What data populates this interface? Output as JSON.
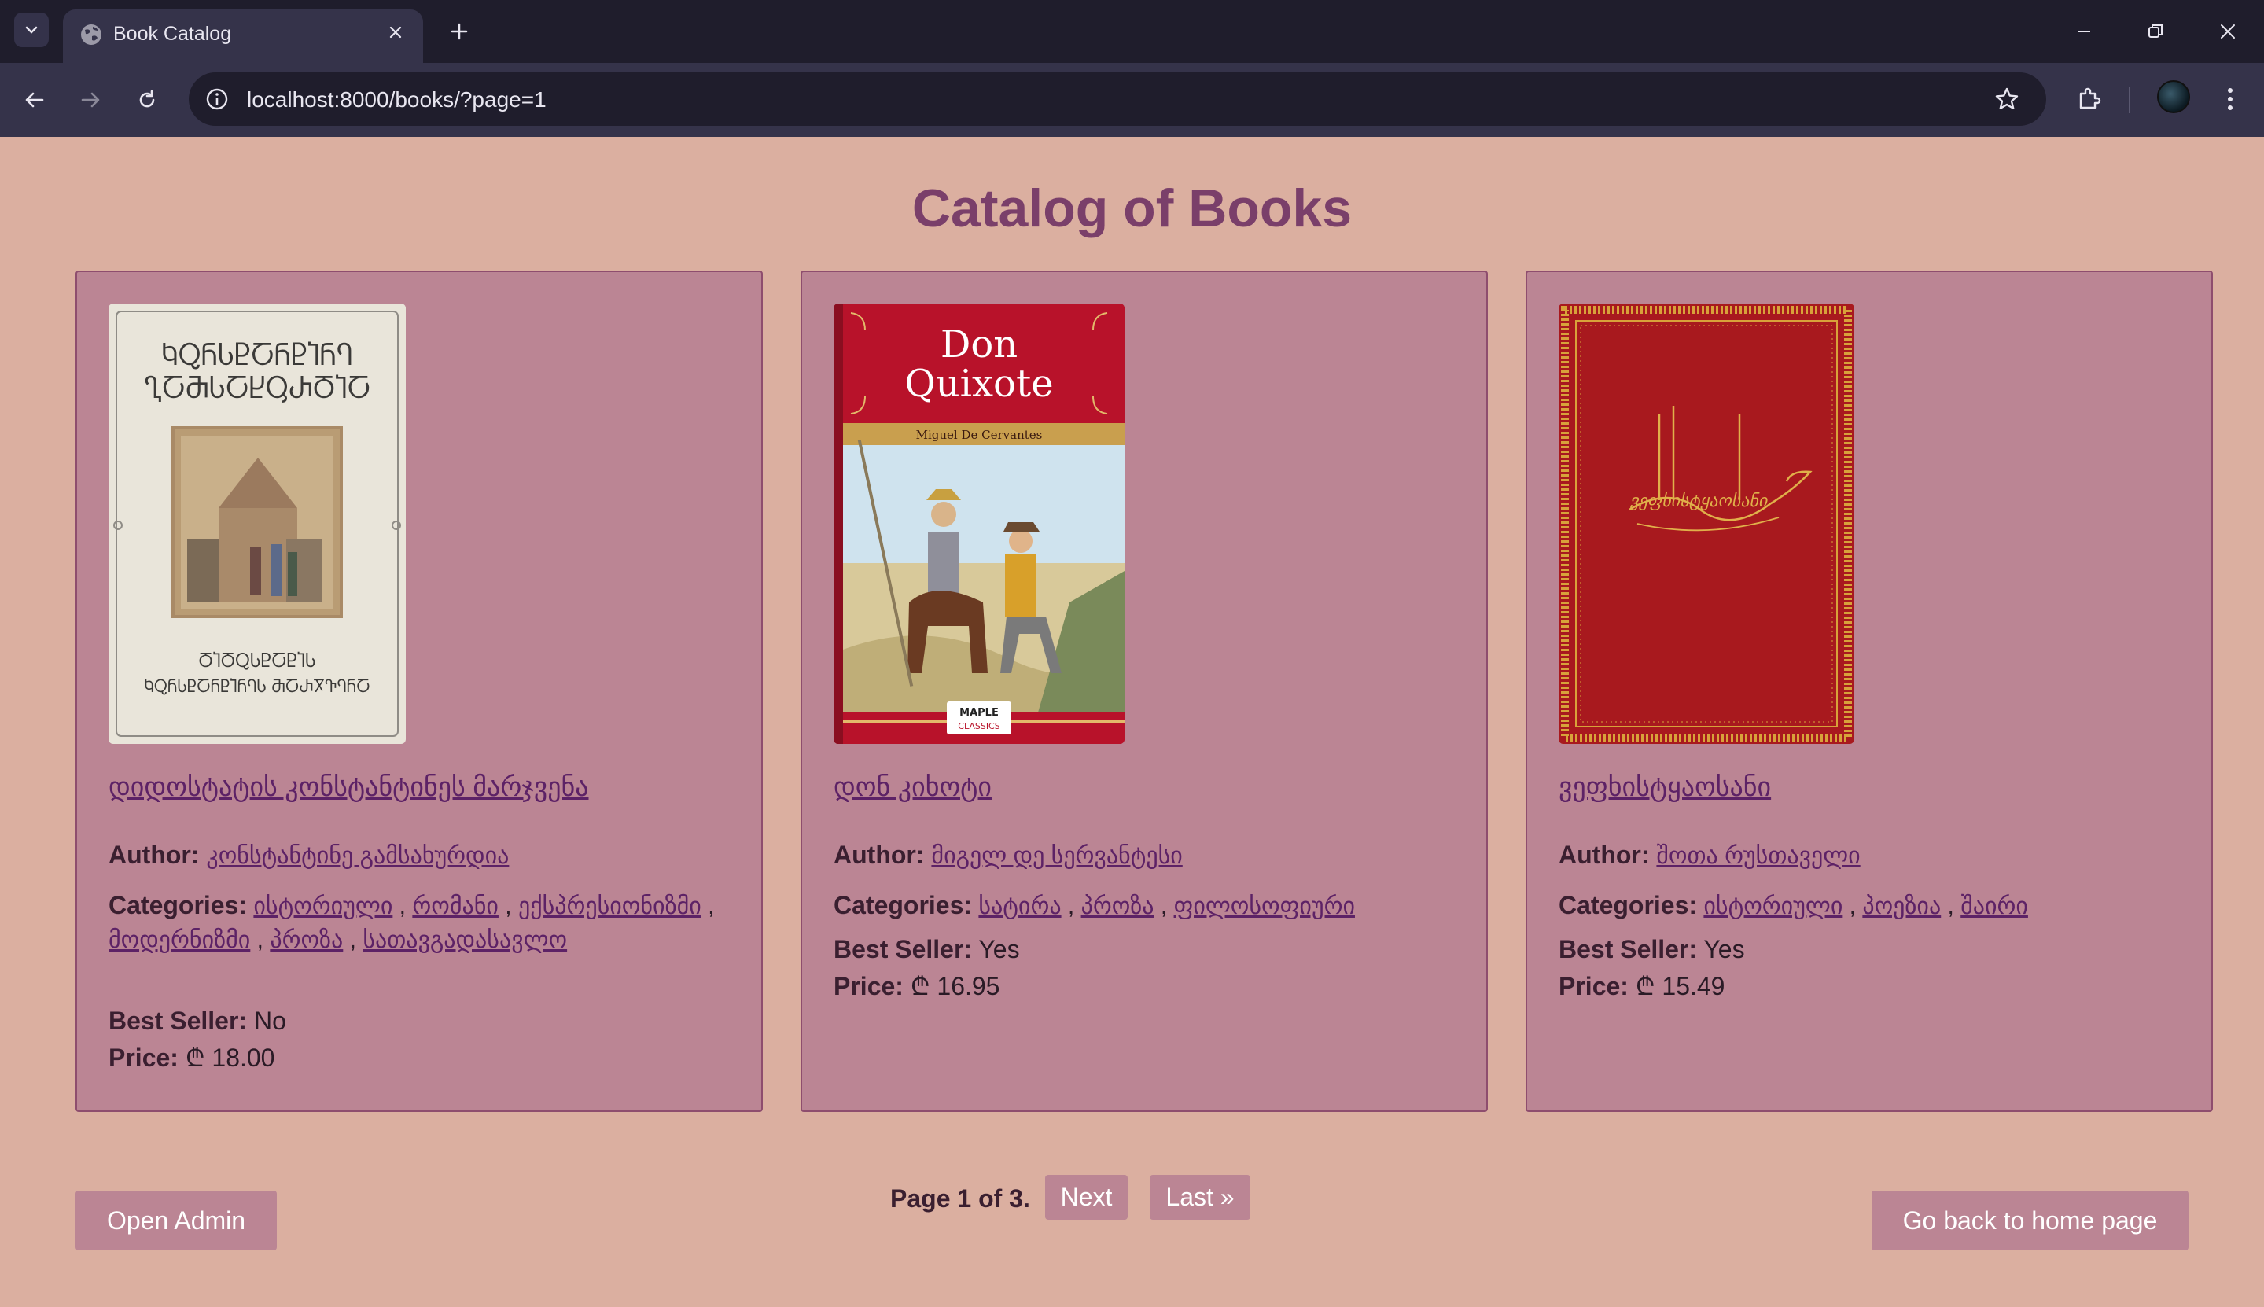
{
  "browser": {
    "tab_title": "Book Catalog",
    "url": "localhost:8000/books/?page=1"
  },
  "page": {
    "title": "Catalog of Books"
  },
  "labels": {
    "author": "Author:",
    "categories": "Categories:",
    "best_seller": "Best Seller:",
    "price": "Price:",
    "sep": " , "
  },
  "books": [
    {
      "title": "დიდოსტატის კონსტანტინეს მარჯვენა",
      "author": "კონსტანტინე გამსახურდია",
      "categories": [
        "ისტორიული",
        "რომანი",
        "ექსპრესიონიზმი",
        "მოდერნიზმი",
        "პროზა",
        "სათავგადასავლო"
      ],
      "best_seller": "No",
      "price": "₾ 18.00",
      "cover": {
        "top_line1": "ႩႭႬႱႲႠႬႲႨႬႤ",
        "top_line2": "ႢႠႫႱႠႾႳႰႣႨႠ",
        "bottom_line1": "ႣႨႣႭႱႲႠႲႨႱ",
        "bottom_line2": "ႩႭႬႱႲႠႬႲႨႬႤႱ ႫႠႰႿႥႤႬႠ"
      }
    },
    {
      "title": "დონ კიხოტი",
      "author": "მიგელ დე სერვანტესი",
      "categories": [
        "სატირა",
        "პროზა",
        "ფილოსოფიური"
      ],
      "best_seller": "Yes",
      "price": "₾ 16.95",
      "cover": {
        "title_line1": "Don",
        "title_line2": "Quixote",
        "author": "Miguel De Cervantes",
        "publisher_line1": "MAPLE",
        "publisher_line2": "CLASSICS"
      }
    },
    {
      "title": "ვეფხისტყაოსანი",
      "author": "შოთა რუსთაველი",
      "categories": [
        "ისტორიული",
        "პოეზია",
        "შაირი"
      ],
      "best_seller": "Yes",
      "price": "₾ 15.49",
      "cover": {
        "calligraphy": "ვეფხისტყაოსანი"
      }
    }
  ],
  "pagination": {
    "info": "Page 1 of 3.",
    "next": "Next",
    "last": "Last »"
  },
  "buttons": {
    "open_admin": "Open Admin",
    "home": "Go back to home page"
  },
  "colors": {
    "page_bg": "#dbafa0",
    "card_bg": "#bb8594",
    "title": "#7a3f6a",
    "link": "#5d2266"
  }
}
